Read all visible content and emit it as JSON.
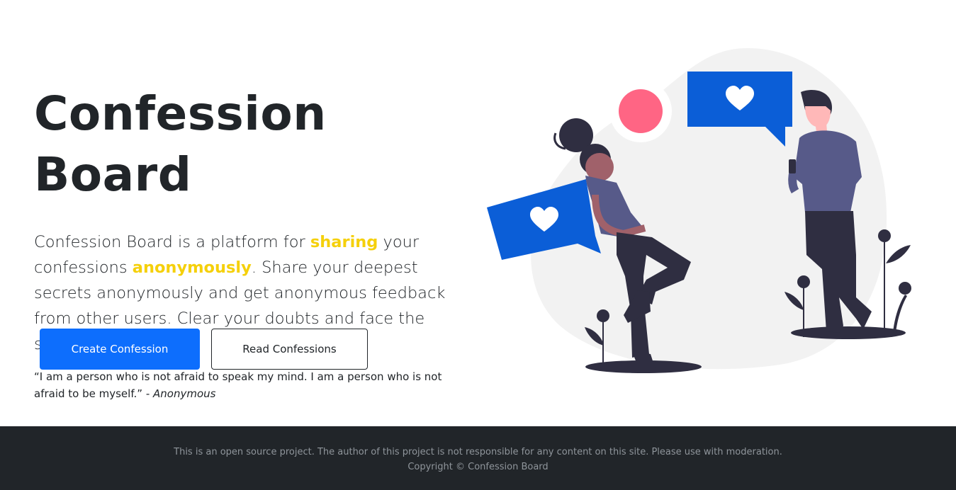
{
  "hero": {
    "title": "Confession Board",
    "lead_part1": "Confession Board is a platform for ",
    "highlight1": "sharing",
    "lead_part2": " your confessions ",
    "highlight2": "anonymously",
    "lead_part3": ". Share your deepest secrets anonymously and get anonymous feedback from other users. Clear your doubts and face the secrets of yourself.",
    "quote": "“I am a person who is not afraid to speak my mind. I am a person who is not afraid to be myself.” - ",
    "quote_author": "Anonymous"
  },
  "buttons": {
    "create": "Create Confession",
    "read": "Read Confessions"
  },
  "footer": {
    "disclaimer": "This is an open source project. The author of this project is not responsible for any content on this site. Please use with moderation.",
    "copyright": "Copyright © Confession Board"
  },
  "colors": {
    "highlight": "#f5d00b",
    "primary": "#0d6efd",
    "footer_bg": "#212529",
    "bubble_blue": "#0b5ed7",
    "bubble_pink": "#ff6584",
    "figure_purple": "#575a89",
    "figure_dark": "#2f2e41"
  },
  "icons": [
    "heart-icon",
    "heart-icon"
  ]
}
